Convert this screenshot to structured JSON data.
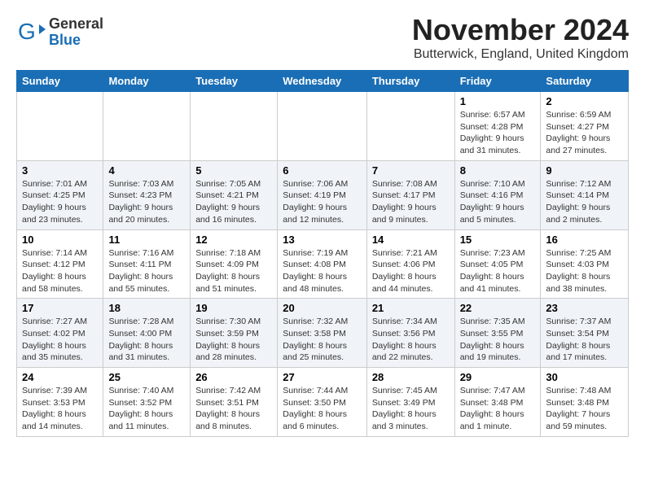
{
  "logo": {
    "general": "General",
    "blue": "Blue"
  },
  "header": {
    "month_year": "November 2024",
    "location": "Butterwick, England, United Kingdom"
  },
  "weekdays": [
    "Sunday",
    "Monday",
    "Tuesday",
    "Wednesday",
    "Thursday",
    "Friday",
    "Saturday"
  ],
  "weeks": [
    [
      {
        "day": "",
        "info": ""
      },
      {
        "day": "",
        "info": ""
      },
      {
        "day": "",
        "info": ""
      },
      {
        "day": "",
        "info": ""
      },
      {
        "day": "",
        "info": ""
      },
      {
        "day": "1",
        "info": "Sunrise: 6:57 AM\nSunset: 4:28 PM\nDaylight: 9 hours and 31 minutes."
      },
      {
        "day": "2",
        "info": "Sunrise: 6:59 AM\nSunset: 4:27 PM\nDaylight: 9 hours and 27 minutes."
      }
    ],
    [
      {
        "day": "3",
        "info": "Sunrise: 7:01 AM\nSunset: 4:25 PM\nDaylight: 9 hours and 23 minutes."
      },
      {
        "day": "4",
        "info": "Sunrise: 7:03 AM\nSunset: 4:23 PM\nDaylight: 9 hours and 20 minutes."
      },
      {
        "day": "5",
        "info": "Sunrise: 7:05 AM\nSunset: 4:21 PM\nDaylight: 9 hours and 16 minutes."
      },
      {
        "day": "6",
        "info": "Sunrise: 7:06 AM\nSunset: 4:19 PM\nDaylight: 9 hours and 12 minutes."
      },
      {
        "day": "7",
        "info": "Sunrise: 7:08 AM\nSunset: 4:17 PM\nDaylight: 9 hours and 9 minutes."
      },
      {
        "day": "8",
        "info": "Sunrise: 7:10 AM\nSunset: 4:16 PM\nDaylight: 9 hours and 5 minutes."
      },
      {
        "day": "9",
        "info": "Sunrise: 7:12 AM\nSunset: 4:14 PM\nDaylight: 9 hours and 2 minutes."
      }
    ],
    [
      {
        "day": "10",
        "info": "Sunrise: 7:14 AM\nSunset: 4:12 PM\nDaylight: 8 hours and 58 minutes."
      },
      {
        "day": "11",
        "info": "Sunrise: 7:16 AM\nSunset: 4:11 PM\nDaylight: 8 hours and 55 minutes."
      },
      {
        "day": "12",
        "info": "Sunrise: 7:18 AM\nSunset: 4:09 PM\nDaylight: 8 hours and 51 minutes."
      },
      {
        "day": "13",
        "info": "Sunrise: 7:19 AM\nSunset: 4:08 PM\nDaylight: 8 hours and 48 minutes."
      },
      {
        "day": "14",
        "info": "Sunrise: 7:21 AM\nSunset: 4:06 PM\nDaylight: 8 hours and 44 minutes."
      },
      {
        "day": "15",
        "info": "Sunrise: 7:23 AM\nSunset: 4:05 PM\nDaylight: 8 hours and 41 minutes."
      },
      {
        "day": "16",
        "info": "Sunrise: 7:25 AM\nSunset: 4:03 PM\nDaylight: 8 hours and 38 minutes."
      }
    ],
    [
      {
        "day": "17",
        "info": "Sunrise: 7:27 AM\nSunset: 4:02 PM\nDaylight: 8 hours and 35 minutes."
      },
      {
        "day": "18",
        "info": "Sunrise: 7:28 AM\nSunset: 4:00 PM\nDaylight: 8 hours and 31 minutes."
      },
      {
        "day": "19",
        "info": "Sunrise: 7:30 AM\nSunset: 3:59 PM\nDaylight: 8 hours and 28 minutes."
      },
      {
        "day": "20",
        "info": "Sunrise: 7:32 AM\nSunset: 3:58 PM\nDaylight: 8 hours and 25 minutes."
      },
      {
        "day": "21",
        "info": "Sunrise: 7:34 AM\nSunset: 3:56 PM\nDaylight: 8 hours and 22 minutes."
      },
      {
        "day": "22",
        "info": "Sunrise: 7:35 AM\nSunset: 3:55 PM\nDaylight: 8 hours and 19 minutes."
      },
      {
        "day": "23",
        "info": "Sunrise: 7:37 AM\nSunset: 3:54 PM\nDaylight: 8 hours and 17 minutes."
      }
    ],
    [
      {
        "day": "24",
        "info": "Sunrise: 7:39 AM\nSunset: 3:53 PM\nDaylight: 8 hours and 14 minutes."
      },
      {
        "day": "25",
        "info": "Sunrise: 7:40 AM\nSunset: 3:52 PM\nDaylight: 8 hours and 11 minutes."
      },
      {
        "day": "26",
        "info": "Sunrise: 7:42 AM\nSunset: 3:51 PM\nDaylight: 8 hours and 8 minutes."
      },
      {
        "day": "27",
        "info": "Sunrise: 7:44 AM\nSunset: 3:50 PM\nDaylight: 8 hours and 6 minutes."
      },
      {
        "day": "28",
        "info": "Sunrise: 7:45 AM\nSunset: 3:49 PM\nDaylight: 8 hours and 3 minutes."
      },
      {
        "day": "29",
        "info": "Sunrise: 7:47 AM\nSunset: 3:48 PM\nDaylight: 8 hours and 1 minute."
      },
      {
        "day": "30",
        "info": "Sunrise: 7:48 AM\nSunset: 3:48 PM\nDaylight: 7 hours and 59 minutes."
      }
    ]
  ]
}
